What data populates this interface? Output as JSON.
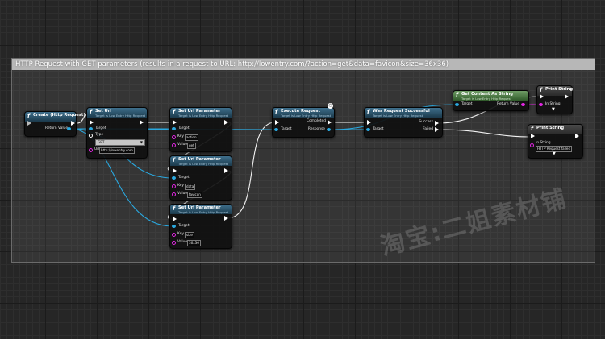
{
  "comment": {
    "title": "HTTP Request with GET parameters (results in a request to URL: http://lowentry.com/?action=get&data=favicon&size=36x36)"
  },
  "nodes": {
    "create": {
      "title": "Create (Http Request)",
      "return": "Return Value"
    },
    "set_url": {
      "title": "Set Url",
      "sub": "Target is Low Entry Http Request",
      "target": "Target",
      "type_label": "Type",
      "type_value": "GET",
      "url_label": "Url",
      "url_value": "http://lowentry.com"
    },
    "param1": {
      "title": "Set Url Parameter",
      "sub": "Target is Low Entry Http Request",
      "target": "Target",
      "key_label": "Key",
      "key_value": "action",
      "value_label": "Value",
      "value_value": "get"
    },
    "param2": {
      "title": "Set Url Parameter",
      "sub": "Target is Low Entry Http Request",
      "target": "Target",
      "key_label": "Key",
      "key_value": "data",
      "value_label": "Value",
      "value_value": "favicon"
    },
    "param3": {
      "title": "Set Url Parameter",
      "sub": "Target is Low Entry Http Request",
      "target": "Target",
      "key_label": "Key",
      "key_value": "size",
      "value_label": "Value",
      "value_value": "36x36"
    },
    "execute": {
      "title": "Execute Request",
      "sub": "Target is Low Entry Http Request",
      "target": "Target",
      "completed": "Completed",
      "response": "Response"
    },
    "was_success": {
      "title": "Was Request Successful",
      "sub": "Target is Low Entry Http Request",
      "target": "Target",
      "success": "Success",
      "failed": "Failed"
    },
    "get_content": {
      "title": "Get Content As String",
      "sub": "Target is Low Entry Http Request",
      "target": "Target",
      "return": "Return Value"
    },
    "print1": {
      "title": "Print String",
      "in_label": "In String"
    },
    "print2": {
      "title": "Print String",
      "in_label": "In String",
      "in_value": "HTTP Request failed"
    }
  },
  "watermark": "淘宝:二姐素材铺"
}
